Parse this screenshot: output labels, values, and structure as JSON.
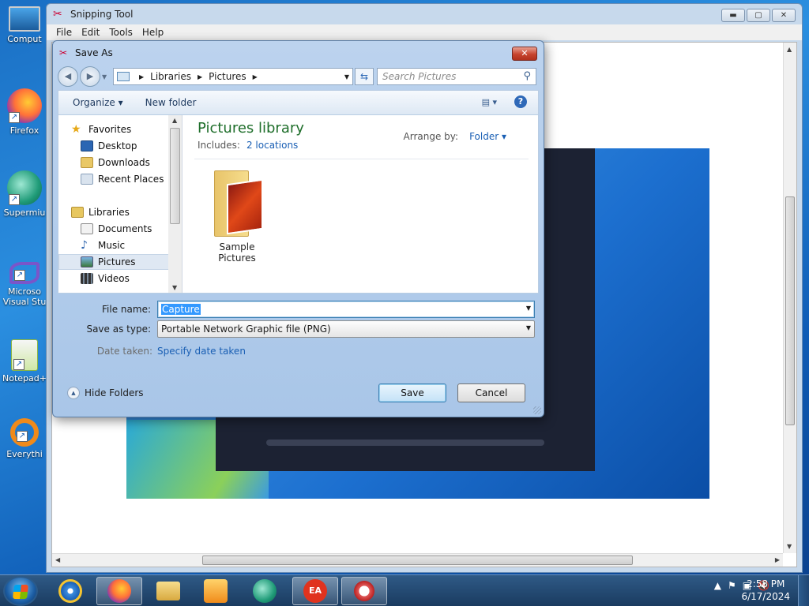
{
  "desktop": {
    "icons": [
      {
        "label": "Comput",
        "icon": "computer-icon"
      },
      {
        "label": "Firefox",
        "icon": "firefox-icon"
      },
      {
        "label": "Supermiu",
        "icon": "supermium-icon"
      },
      {
        "label": "Microso",
        "label2": "Visual Stu",
        "icon": "visual-studio-icon"
      },
      {
        "label": "Notepad+",
        "icon": "notepad-plus-icon"
      },
      {
        "label": "Everythi",
        "icon": "everything-search-icon"
      }
    ]
  },
  "snipping_tool": {
    "title": "Snipping Tool",
    "menu": [
      "File",
      "Edit",
      "Tools",
      "Help"
    ],
    "buttons": {
      "minimize": "▬",
      "maximize": "▢",
      "close": "✕"
    }
  },
  "dialog": {
    "title": "Save As",
    "close": "✕",
    "address": {
      "parts": [
        "Libraries",
        "Pictures"
      ]
    },
    "search_placeholder": "Search Pictures",
    "toolbar": {
      "organize": "Organize ▾",
      "new_folder": "New folder",
      "help": "?"
    },
    "nav": {
      "favorites": "Favorites",
      "desktop": "Desktop",
      "downloads": "Downloads",
      "recent": "Recent Places",
      "libraries": "Libraries",
      "documents": "Documents",
      "music": "Music",
      "pictures": "Pictures",
      "videos": "Videos"
    },
    "library": {
      "title": "Pictures library",
      "includes_label": "Includes:",
      "includes_link": "2 locations",
      "arrange_label": "Arrange by:",
      "arrange_value": "Folder ▾"
    },
    "folders": [
      {
        "name": "Sample Pictures"
      }
    ],
    "form": {
      "filename_label": "File name:",
      "filename_value": "Capture",
      "savetype_label": "Save as type:",
      "savetype_value": "Portable Network Graphic file (PNG)",
      "date_label": "Date taken:",
      "date_link": "Specify date taken",
      "hide_folders": "Hide Folders",
      "save": "Save",
      "cancel": "Cancel"
    }
  },
  "taskbar": {
    "apps": [
      {
        "name": "internet-explorer",
        "color": "#3b8ee0"
      },
      {
        "name": "firefox",
        "color": "#e8642a"
      },
      {
        "name": "file-explorer",
        "color": "#e8c45a"
      },
      {
        "name": "media-player",
        "color": "#f0a030"
      },
      {
        "name": "supermium",
        "color": "#2aa774"
      },
      {
        "name": "ea-app",
        "color": "#e0331e"
      },
      {
        "name": "snipping-tool",
        "color": "#d44"
      }
    ],
    "time": "2:58 PM",
    "date": "6/17/2024"
  }
}
